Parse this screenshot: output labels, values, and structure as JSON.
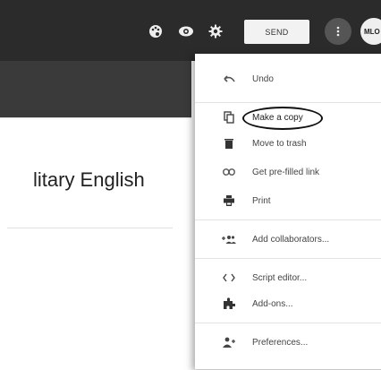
{
  "header": {
    "send_label": "SEND",
    "avatar_text": "MLO",
    "icons": [
      "palette-icon",
      "eye-icon",
      "gear-icon",
      "more-vert-icon"
    ]
  },
  "doc": {
    "title_fragment": "litary English"
  },
  "menu": {
    "items": [
      {
        "label": "Undo",
        "icon": "undo-icon"
      },
      {
        "label": "Make a copy",
        "icon": "copy-icon"
      },
      {
        "label": "Move to trash",
        "icon": "trash-icon"
      },
      {
        "label": "Get pre-filled link",
        "icon": "link-icon"
      },
      {
        "label": "Print",
        "icon": "print-icon"
      },
      {
        "label": "Add collaborators...",
        "icon": "add-people-icon"
      },
      {
        "label": "Script editor...",
        "icon": "code-icon"
      },
      {
        "label": "Add-ons...",
        "icon": "puzzle-icon"
      },
      {
        "label": "Preferences...",
        "icon": "person-settings-icon"
      }
    ]
  },
  "colors": {
    "header_bg": "#2b2b2b",
    "menu_bg": "#ffffff",
    "highlight_circle": "#111111"
  }
}
